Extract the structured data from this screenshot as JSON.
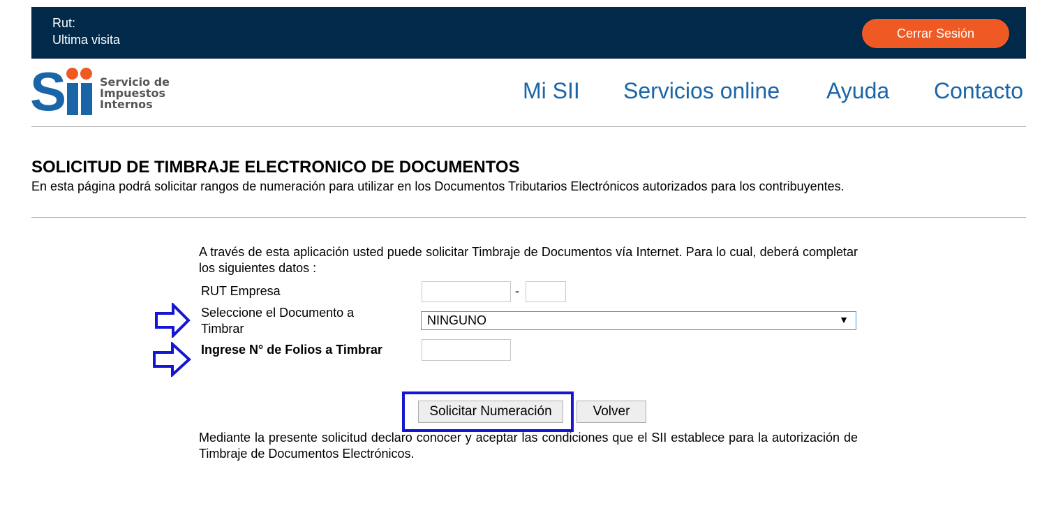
{
  "topbar": {
    "rut_label": "Rut:",
    "last_visit_label": "Ultima visita",
    "logout_label": "Cerrar Sesión",
    "bg_color": "#00294a",
    "button_color": "#ef5a24"
  },
  "header": {
    "logo_text_line1": "Servicio de",
    "logo_text_line2": "Impuestos",
    "logo_text_line3": "Internos",
    "logo_mark": "Sii",
    "nav": [
      "Mi SII",
      "Servicios online",
      "Ayuda",
      "Contacto"
    ],
    "brand_color": "#1a65a8"
  },
  "page": {
    "title": "SOLICITUD DE TIMBRAJE ELECTRONICO DE DOCUMENTOS",
    "subtitle": "En esta página podrá solicitar rangos de numeración para utilizar en los Documentos Tributarios Electrónicos autorizados para los contribuyentes."
  },
  "form": {
    "intro": "A través de esta aplicación usted puede solicitar Timbraje de Documentos vía Internet. Para lo cual, deberá completar los siguientes datos :",
    "rut_label": "RUT Empresa",
    "rut_value": "",
    "rut_dv_value": "",
    "rut_separator": "-",
    "document_label_line1": "Seleccione el Documento a",
    "document_label_line2": "Timbrar",
    "document_selected": "NINGUNO",
    "folios_label": "Ingrese N° de Folios a Timbrar",
    "folios_value": "",
    "submit_label": "Solicitar Numeración",
    "back_label": "Volver",
    "footnote": "Mediante la presente solicitud declaro conocer y aceptar las condiciones que el SII establece para la autorización de Timbraje de Documentos Electrónicos."
  },
  "annotations": {
    "arrow_icon": "right-arrow-outline-icon",
    "highlight_color": "#1515d4"
  }
}
